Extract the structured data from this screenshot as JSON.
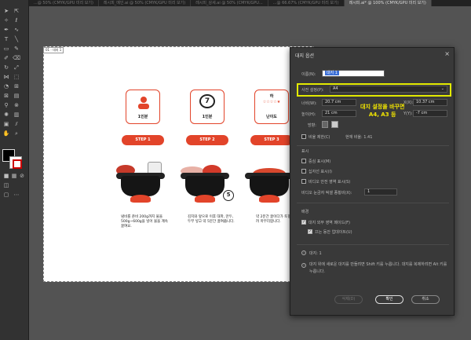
{
  "tabs": [
    {
      "label": "...@ 50% (CMYK/GPU 미리 보기)"
    },
    {
      "label": "레시피_메인.ai @ 50% (CMYK/GPU 미리 보기)"
    },
    {
      "label": "레시피_상세.ai @ 50% (CMYK/GPU..."
    },
    {
      "label": "...@ 66.67% (CMYK/GPU 미리 보기)"
    },
    {
      "label": "레시피.ai* @ 100% (CMYK/GPU 미리 보기)"
    }
  ],
  "artboard": {
    "label": "01 - 대지 1",
    "cards": [
      {
        "label": "1인분",
        "icon": "person-icon"
      },
      {
        "label": "1인분",
        "icon": "clock-7-icon",
        "num": "7"
      },
      {
        "label": "난이도",
        "icon": "stars-icon",
        "top": "하",
        "stars": "☆☆☆☆★"
      }
    ],
    "steps": [
      "STEP 1",
      "STEP 2",
      "STEP 3"
    ],
    "descs": [
      "냄비를 준비 200g까지 물을 500g~600g을 넣어 물을 계속 끓여요.",
      "김치와 앞으로 이후 대파, 만두, 두부 넣고 약 5분간 끓여줍니다.",
      "약 2분간 끓이다가 토핑을 더 올려 마무리합니다."
    ],
    "badge_num": "5"
  },
  "dialog": {
    "title": "대지 옵션",
    "name_label": "이름(N):",
    "name_value": "대지 1",
    "preset_label": "사전 설정(P):",
    "preset_value": "A4",
    "width_label": "너비(W):",
    "width_value": "20.7 cm",
    "height_label": "높이(H):",
    "height_value": "21 cm",
    "x_label": "X(X):",
    "x_value": "10.37 cm",
    "y_label": "Y(Y):",
    "y_value": "-7 cm",
    "orientation_label": "방향:",
    "ratio_label": "비율 제한(C)",
    "current_ratio_label": "현재 비율: 1.41",
    "display_section": "표시",
    "center_mark": "중심 표시(M)",
    "crosshair": "십자선 표시(I)",
    "video_safe": "비디오 안전 영역 표시(S)",
    "ruler_par_label": "비디오 눈금자 픽셀 종횡비(X):",
    "ruler_par_value": "1",
    "bg_section": "배경",
    "fade_outside": "대지 외부 영역 페이드(F)",
    "update_drag": "끄는 동안 업데이트(U)",
    "count_label": "대지: 1",
    "info_text": "대지 위에 새로운 대지를 만들려면 Shift 키를 누릅니다. 대지를 복제하려면 Alt 키를 누릅니다.",
    "delete_btn": "삭제(D)",
    "ok_btn": "확인",
    "cancel_btn": "취소",
    "overlay_note_line1": "대지 설정을 바꾸면",
    "overlay_note_line2": "A4, A3 등"
  },
  "colors": {
    "accent_red": "#e2442a",
    "highlight_yellow": "#e3ea00",
    "selection_blue": "#3b6fd6"
  }
}
